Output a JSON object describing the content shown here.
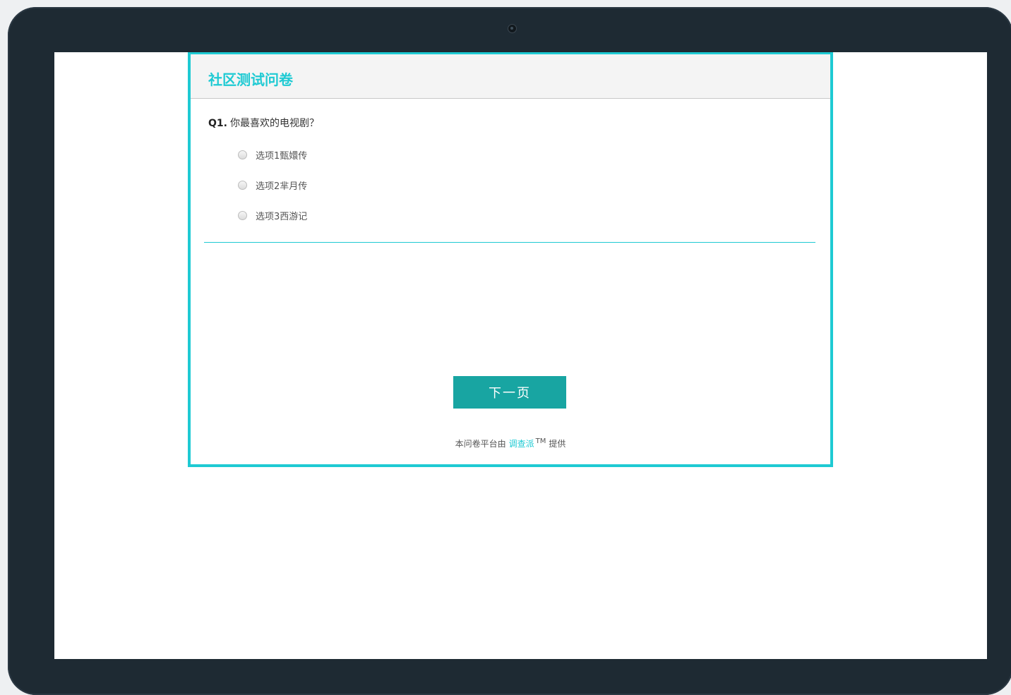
{
  "survey": {
    "title": "社区测试问卷",
    "question": {
      "number": "Q1.",
      "text": "你最喜欢的电视剧？",
      "options": [
        {
          "label": "选项1甄嬛传",
          "selected": false
        },
        {
          "label": "选项2芈月传",
          "selected": false
        },
        {
          "label": "选项3西游记",
          "selected": false
        }
      ]
    },
    "next_button": "下一页",
    "footer": {
      "prefix": "本问卷平台由",
      "brand": "调查派",
      "tm": "TM",
      "suffix": "提供"
    }
  },
  "colors": {
    "accent": "#1ecad3",
    "button": "#18a5a2",
    "bezel": "#1e2a33"
  }
}
